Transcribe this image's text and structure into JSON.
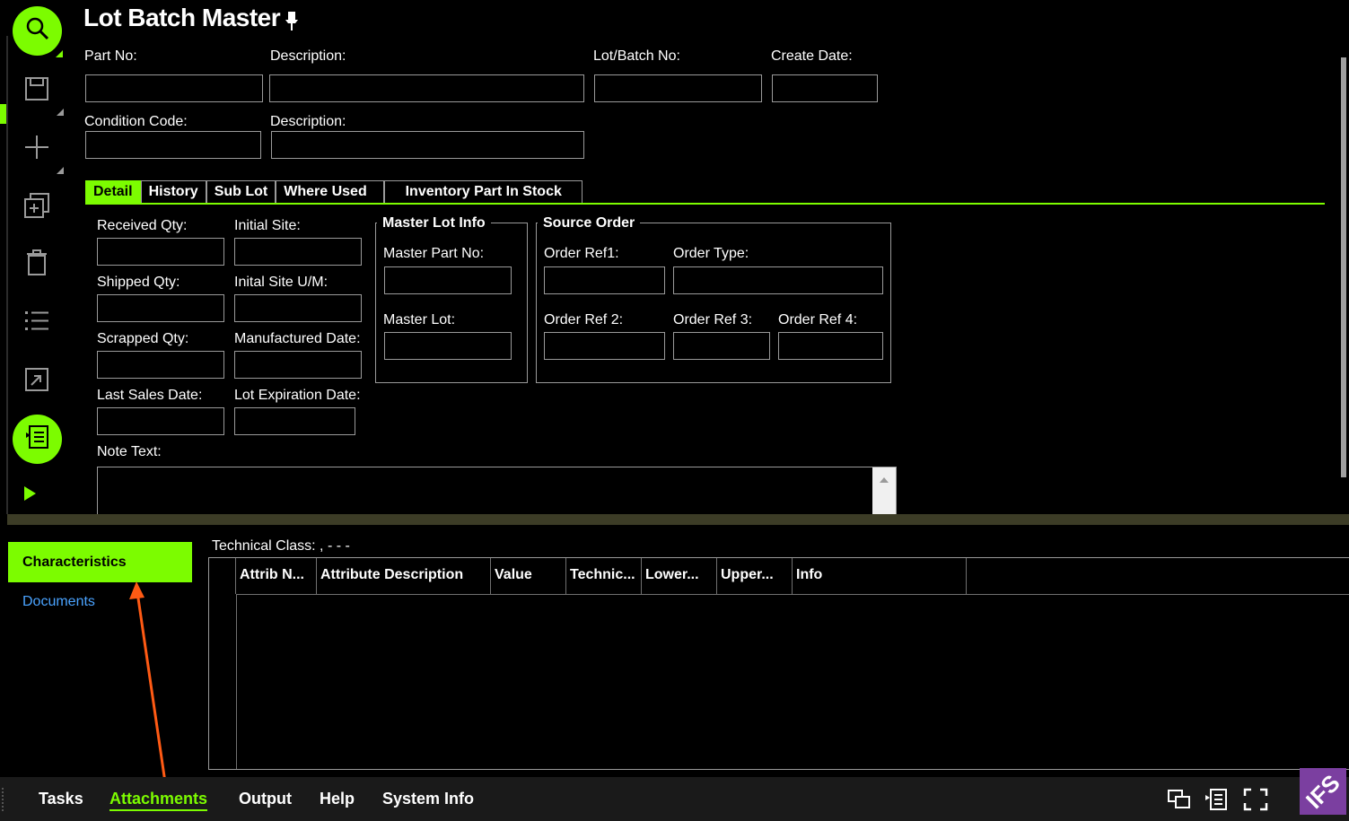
{
  "page": {
    "title": "Lot Batch Master"
  },
  "header_fields": {
    "part_no_label": "Part No:",
    "description_label": "Description:",
    "lot_batch_no_label": "Lot/Batch No:",
    "create_date_label": "Create Date:",
    "condition_code_label": "Condition Code:",
    "condition_description_label": "Description:"
  },
  "tabs": [
    {
      "label": "Detail",
      "active": true
    },
    {
      "label": "History"
    },
    {
      "label": "Sub Lot"
    },
    {
      "label": "Where Used"
    },
    {
      "label": "Inventory Part In Stock"
    }
  ],
  "detail": {
    "received_qty_label": "Received  Qty:",
    "initial_site_label": "Initial Site:",
    "shipped_qty_label": "Shipped Qty:",
    "initial_site_um_label": "Inital Site U/M:",
    "scrapped_qty_label": "Scrapped Qty:",
    "manufactured_date_label": "Manufactured Date:",
    "last_sales_date_label": "Last Sales Date:",
    "lot_expiration_date_label": "Lot Expiration Date:",
    "note_text_label": "Note Text:"
  },
  "master_lot_info": {
    "title": "Master Lot Info",
    "master_part_no_label": "Master Part No:",
    "master_lot_label": "Master Lot:"
  },
  "source_order": {
    "title": "Source Order",
    "order_ref1_label": "Order Ref1:",
    "order_type_label": "Order Type:",
    "order_ref2_label": "Order Ref 2:",
    "order_ref3_label": "Order Ref 3:",
    "order_ref4_label": "Order Ref 4:"
  },
  "attachments": {
    "nav": [
      {
        "label": "Characteristics",
        "active": true
      },
      {
        "label": "Documents"
      }
    ],
    "technical_class_label": "Technical Class: ,  -  -  -",
    "columns": [
      "Attrib N...",
      "Attribute Description",
      "Value",
      "Technic...",
      "Lower...",
      "Upper...",
      "Info"
    ]
  },
  "statusbar": {
    "items": [
      {
        "label": "Tasks"
      },
      {
        "label": "Attachments",
        "active": true
      },
      {
        "label": "Output"
      },
      {
        "label": "Help"
      },
      {
        "label": "System Info"
      }
    ],
    "logo_text": "IFS"
  },
  "colors": {
    "accent": "#7cfc00",
    "link": "#4aa3ff",
    "annotation_arrow": "#ff5a14",
    "logo": "#7b3fa0"
  },
  "icons": [
    "search-icon",
    "save-icon",
    "new-icon",
    "duplicate-icon",
    "delete-icon",
    "list-icon",
    "open-detail-icon",
    "details-icon",
    "play-icon",
    "pin-icon"
  ]
}
